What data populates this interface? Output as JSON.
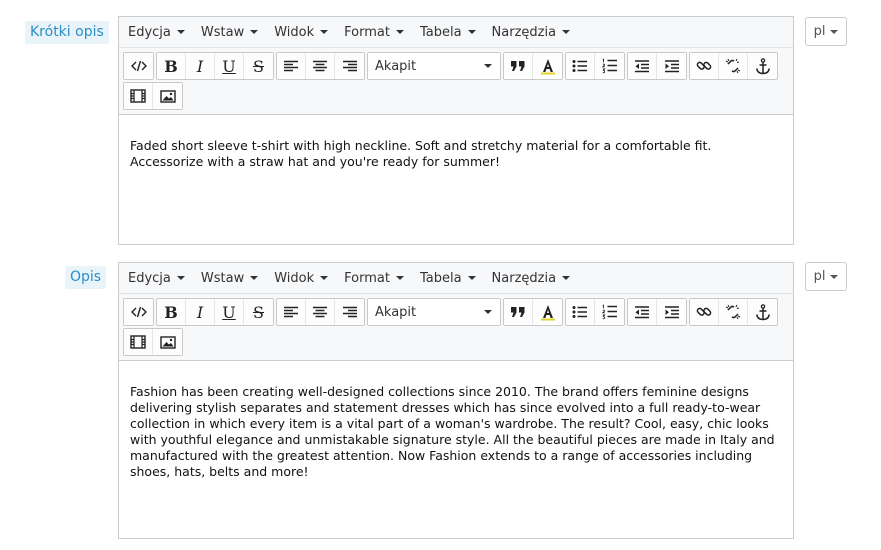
{
  "fields": [
    {
      "label": "Krótki opis",
      "lang": "pl",
      "menus": [
        "Edycja",
        "Wstaw",
        "Widok",
        "Format",
        "Tabela",
        "Narzędzia"
      ],
      "format_select": "Akapit",
      "content": "Faded short sleeve t-shirt with high neckline. Soft and stretchy material for a comfortable fit. Accessorize with a straw hat and you're ready for summer!"
    },
    {
      "label": "Opis",
      "lang": "pl",
      "menus": [
        "Edycja",
        "Wstaw",
        "Widok",
        "Format",
        "Tabela",
        "Narzędzia"
      ],
      "format_select": "Akapit",
      "content": "Fashion has been creating well-designed collections since 2010. The brand offers feminine designs delivering stylish separates and statement dresses which has since evolved into a full ready-to-wear collection in which every item is a vital part of a woman's wardrobe. The result? Cool, easy, chic looks with youthful elegance and unmistakable signature style. All the beautiful pieces are made in Italy and manufactured with the greatest attention. Now Fashion extends to a range of accessories including shoes, hats, belts and more!"
    }
  ],
  "toolbar_glyphs": {
    "bold": "B",
    "italic": "I",
    "underline": "U",
    "strikethrough": "S"
  },
  "icons": {
    "source_code": "source-code-icon",
    "align_left": "align-left-icon",
    "align_center": "align-center-icon",
    "align_right": "align-right-icon",
    "blockquote": "blockquote-icon",
    "text_color": "text-color-icon",
    "bullet_list": "bullet-list-icon",
    "numbered_list": "numbered-list-icon",
    "outdent": "outdent-icon",
    "indent": "indent-icon",
    "link": "link-icon",
    "unlink": "unlink-icon",
    "anchor": "anchor-icon",
    "media": "film-icon",
    "image": "image-icon"
  },
  "colors": {
    "label_text": "#2a8fc7",
    "label_bg": "#e9f3fa",
    "text_color_swatch": "#e2d126"
  }
}
